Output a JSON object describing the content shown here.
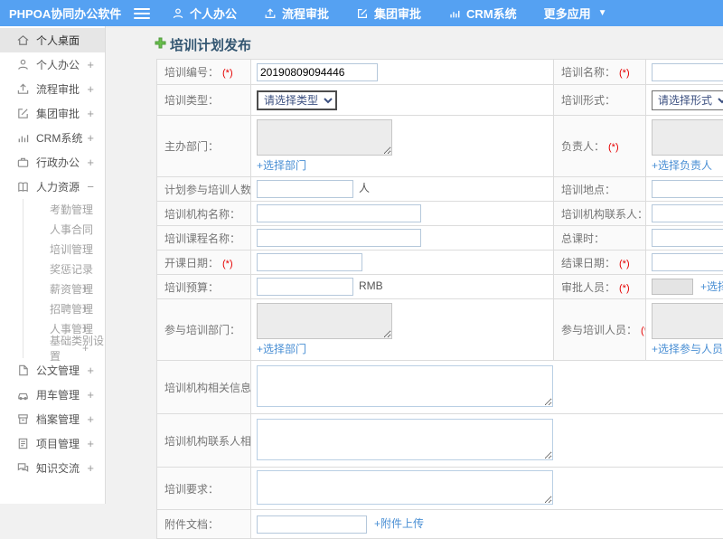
{
  "header": {
    "brand": "PHPOA协同办公软件",
    "nav": [
      {
        "label": "个人办公"
      },
      {
        "label": "流程审批"
      },
      {
        "label": "集团审批"
      },
      {
        "label": "CRM系统"
      },
      {
        "label": "更多应用"
      }
    ]
  },
  "sidebar": {
    "items_top": [
      {
        "label": "个人桌面",
        "expand": ""
      },
      {
        "label": "个人办公",
        "expand": "+"
      },
      {
        "label": "流程审批",
        "expand": "+"
      },
      {
        "label": "集团审批",
        "expand": "+"
      },
      {
        "label": "CRM系统",
        "expand": "+"
      },
      {
        "label": "行政办公",
        "expand": "+"
      },
      {
        "label": "人力资源",
        "expand": "−"
      }
    ],
    "sub_items": [
      {
        "label": "考勤管理",
        "expand": ""
      },
      {
        "label": "人事合同",
        "expand": ""
      },
      {
        "label": "培训管理",
        "expand": ""
      },
      {
        "label": "奖惩记录",
        "expand": ""
      },
      {
        "label": "薪资管理",
        "expand": "+"
      },
      {
        "label": "招聘管理",
        "expand": "+"
      },
      {
        "label": "人事管理",
        "expand": "+"
      },
      {
        "label": "基础类别设置",
        "expand": "+"
      }
    ],
    "items_bottom": [
      {
        "label": "公文管理",
        "expand": "+"
      },
      {
        "label": "用车管理",
        "expand": "+"
      },
      {
        "label": "档案管理",
        "expand": "+"
      },
      {
        "label": "项目管理",
        "expand": "+"
      },
      {
        "label": "知识交流",
        "expand": "+"
      }
    ]
  },
  "page": {
    "title": "培训计划发布"
  },
  "form": {
    "req": "(*)",
    "rows": {
      "number": {
        "label": "培训编号：",
        "value": "20190809094446"
      },
      "name": {
        "label": "培训名称："
      },
      "type": {
        "label": "培训类型：",
        "selected": "请选择类型"
      },
      "mode": {
        "label": "培训形式：",
        "selected": "请选择形式"
      },
      "host_dept": {
        "label": "主办部门：",
        "link": "+选择部门"
      },
      "leader": {
        "label": "负责人：",
        "link": "+选择负责人"
      },
      "planned_count": {
        "label": "计划参与培训人数：",
        "unit": "人"
      },
      "location": {
        "label": "培训地点："
      },
      "org_name": {
        "label": "培训机构名称："
      },
      "org_contact": {
        "label": "培训机构联系人："
      },
      "course_name": {
        "label": "培训课程名称："
      },
      "total_hours": {
        "label": "总课时："
      },
      "start_date": {
        "label": "开课日期："
      },
      "end_date": {
        "label": "结课日期："
      },
      "budget": {
        "label": "培训预算：",
        "unit": "RMB"
      },
      "approver": {
        "label": "审批人员：",
        "link": "+选择审批人员"
      },
      "join_dept": {
        "label": "参与培训部门：",
        "link": "+选择部门"
      },
      "join_people": {
        "label": "参与培训人员：",
        "link": "+选择参与人员"
      },
      "org_info": {
        "label": "培训机构相关信息："
      },
      "org_contact_info": {
        "label": "培训机构联系人相关信息："
      },
      "requirements": {
        "label": "培训要求："
      },
      "attachment": {
        "label": "附件文档：",
        "link": "+附件上传"
      }
    }
  },
  "colors": {
    "header": "#55a1f2",
    "link": "#4a8fd4",
    "required": "#e60000",
    "title": "#335671"
  }
}
